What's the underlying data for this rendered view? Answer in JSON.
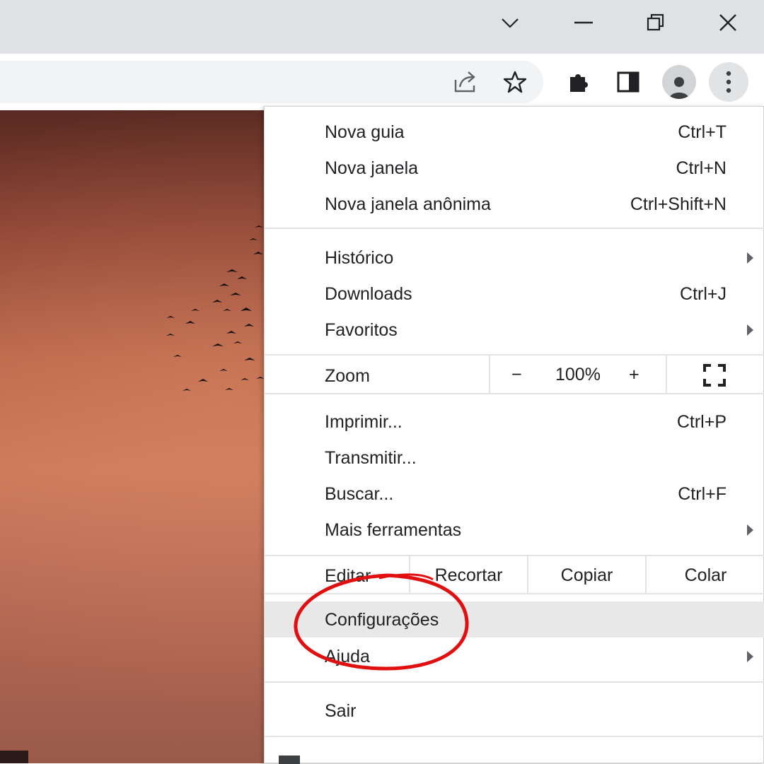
{
  "window": {
    "controls": {
      "dropdown_icon": "chevron-down-icon",
      "minimize_icon": "minimize-icon",
      "restore_icon": "restore-icon",
      "close_icon": "close-icon"
    }
  },
  "toolbar": {
    "icons": [
      "share-icon",
      "star-icon",
      "extensions-icon",
      "side-panel-icon",
      "profile-icon",
      "menu-icon"
    ]
  },
  "menu": {
    "group1": [
      {
        "label": "Nova guia",
        "shortcut": "Ctrl+T"
      },
      {
        "label": "Nova janela",
        "shortcut": "Ctrl+N"
      },
      {
        "label": "Nova janela anônima",
        "shortcut": "Ctrl+Shift+N"
      }
    ],
    "group2": [
      {
        "label": "Histórico",
        "shortcut": ""
      },
      {
        "label": "Downloads",
        "shortcut": "Ctrl+J"
      },
      {
        "label": "Favoritos",
        "shortcut": ""
      }
    ],
    "zoom": {
      "label": "Zoom",
      "minus": "−",
      "value": "100%",
      "plus": "+"
    },
    "group3": [
      {
        "label": "Imprimir...",
        "shortcut": "Ctrl+P"
      },
      {
        "label": "Transmitir...",
        "shortcut": ""
      },
      {
        "label": "Buscar...",
        "shortcut": "Ctrl+F"
      },
      {
        "label": "Mais ferramentas",
        "shortcut": ""
      }
    ],
    "edit": {
      "label": "Editar",
      "cut": "Recortar",
      "copy": "Copiar",
      "paste": "Colar"
    },
    "settings": {
      "label": "Configurações"
    },
    "help": {
      "label": "Ajuda"
    },
    "exit": {
      "label": "Sair"
    }
  },
  "colors": {
    "titlebar": "#dfe1e5",
    "annotation": "#e01010",
    "highlight": "#e8e8e8"
  }
}
